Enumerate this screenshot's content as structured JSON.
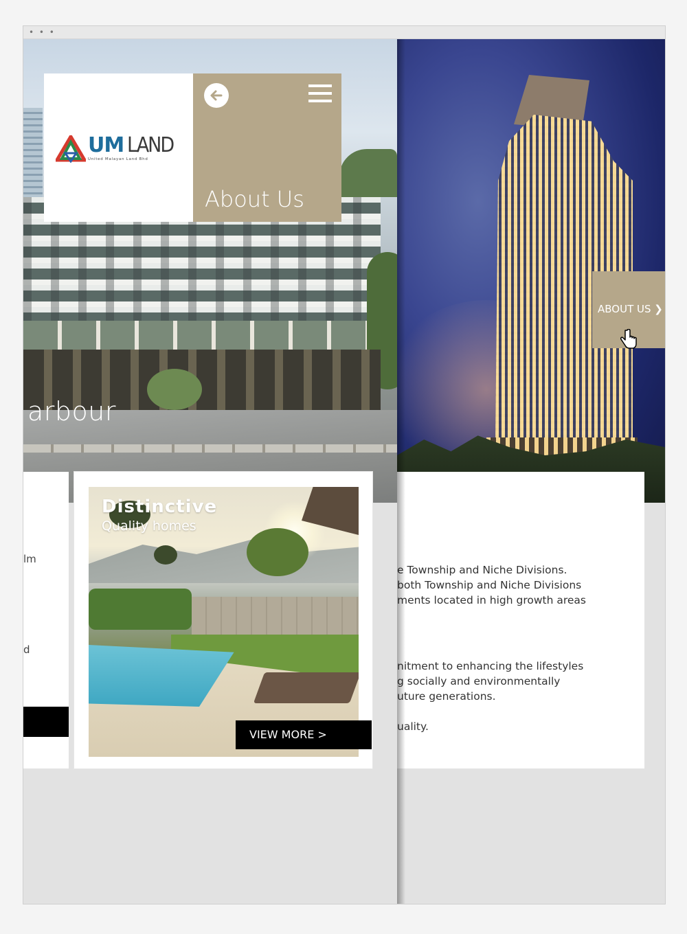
{
  "browser": {
    "dots": "• • •"
  },
  "left_page": {
    "hero_caption": "arbour",
    "logo": {
      "brand_um": "UM",
      "brand_land": "LAND",
      "tagline": "United Malayan Land Bhd"
    },
    "header": {
      "title": "About Us",
      "back_icon": "arrow-left-icon",
      "menu_icon": "hamburger-menu-icon"
    },
    "partial_card": {
      "line1": "lm",
      "line2": "d"
    },
    "feature_card": {
      "heading": "Distinctive",
      "subheading": "Quality homes",
      "button_label": "VIEW MORE >"
    }
  },
  "right_page": {
    "about_tab": {
      "label": "ABOUT US ❯",
      "cursor_icon": "hand-pointer-icon"
    },
    "text_card": {
      "paragraph1": [
        "e Township and Niche Divisions.",
        "both Township and Niche Divisions",
        "ments located in high growth areas"
      ],
      "paragraph2": [
        "nitment to enhancing the lifestyles",
        "g socially and environmentally",
        "uture generations."
      ],
      "paragraph3": [
        "uality."
      ]
    }
  },
  "colors": {
    "accent_tan": "#b5a78a",
    "logo_blue": "#1e6d9c",
    "button_black": "#000000",
    "page_background": "#e2e2e2"
  }
}
